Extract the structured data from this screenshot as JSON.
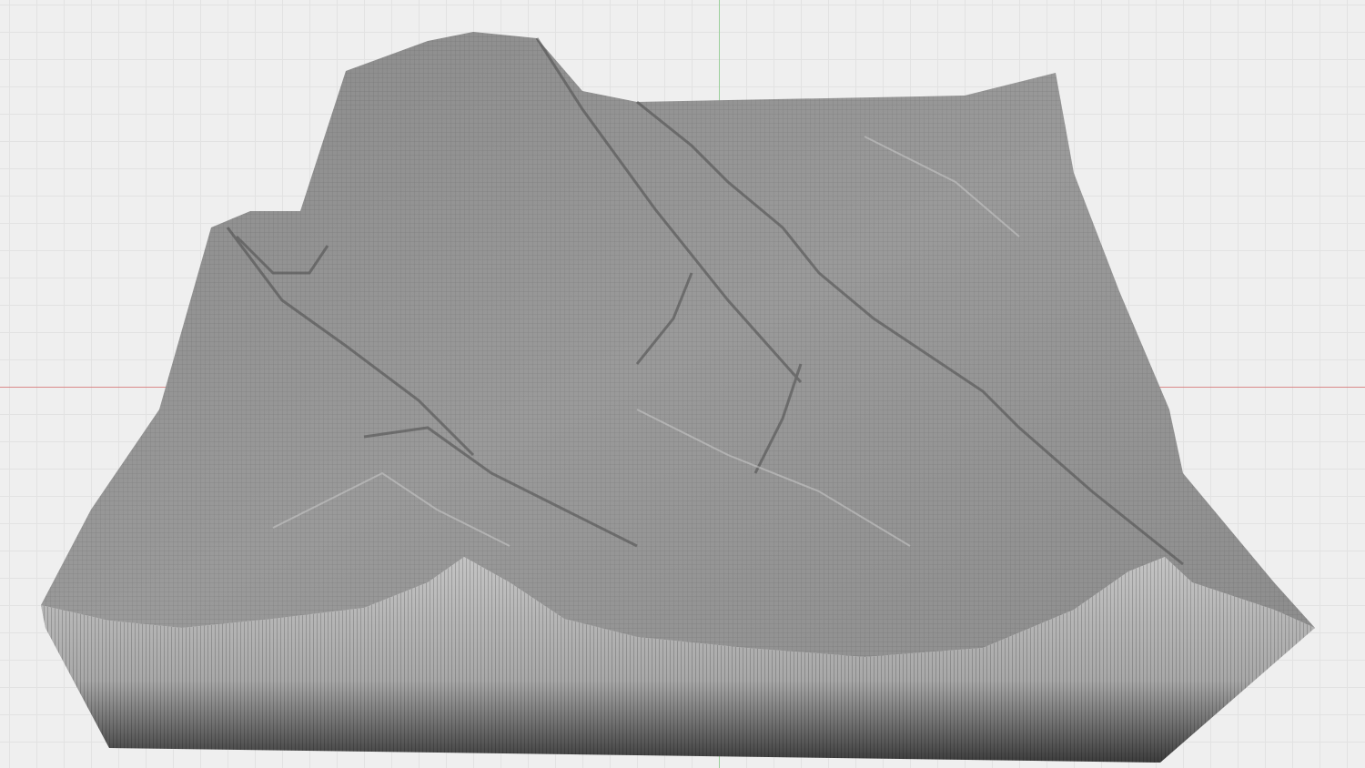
{
  "viewport": {
    "view": "perspective",
    "object": "terrain-mesh",
    "colors": {
      "background": "#efefef",
      "grid": "#e2e2e2",
      "x_axis": "#d98a8a",
      "y_axis": "#9ccf9c",
      "mesh_top": "#8f8f8f",
      "mesh_side": "#b4b4b4",
      "mesh_wire": "#3a3a3a"
    }
  }
}
